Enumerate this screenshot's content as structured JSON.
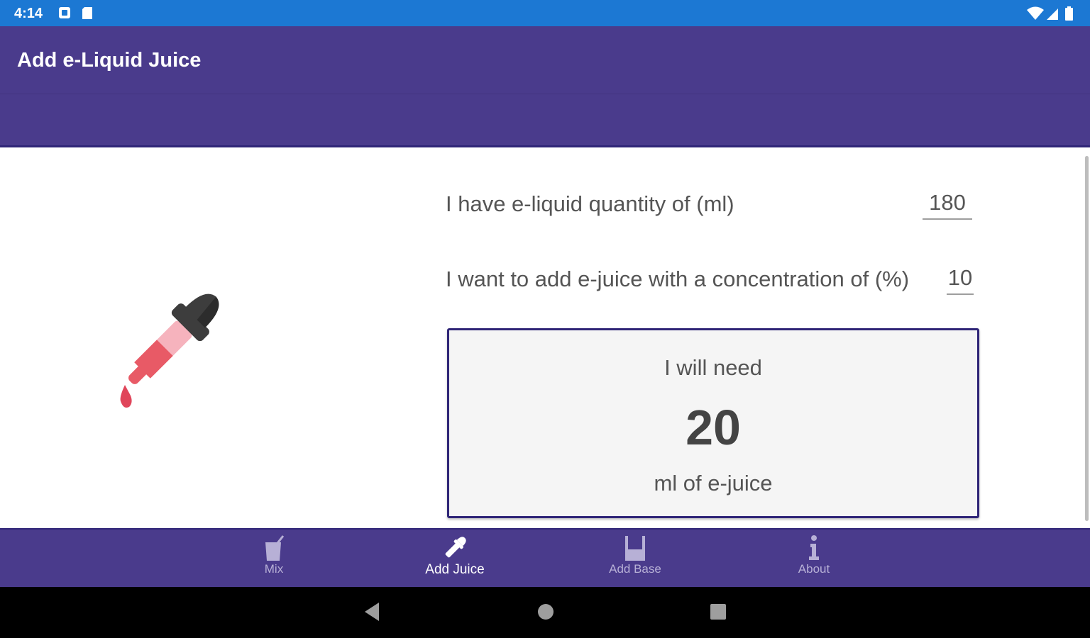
{
  "status_bar": {
    "time": "4:14",
    "icons": [
      "notification-icon",
      "sd-card-icon",
      "wifi-icon",
      "signal-icon",
      "battery-icon"
    ]
  },
  "app_bar": {
    "title": "Add e-Liquid Juice"
  },
  "illustration": {
    "icon": "dropper-icon",
    "colors": {
      "cap": "#3d3d3d",
      "tube_light": "#f6b3bd",
      "tube_dark": "#e85a66",
      "drop": "#e0455a"
    }
  },
  "form": {
    "quantity_label": "I have e-liquid quantity of (ml)",
    "quantity_value": "180",
    "concentration_label": "I want to add e-juice with a concentration of (%)",
    "concentration_value": "10"
  },
  "result": {
    "line1": "I will need",
    "value": "20",
    "line3": "ml of e-juice"
  },
  "bottom_nav": {
    "items": [
      {
        "label": "Mix",
        "icon": "mix-glass-icon",
        "active": false
      },
      {
        "label": "Add Juice",
        "icon": "dropper-icon",
        "active": true
      },
      {
        "label": "Add Base",
        "icon": "beaker-icon",
        "active": false
      },
      {
        "label": "About",
        "icon": "info-icon",
        "active": false
      }
    ]
  },
  "system_nav": {
    "buttons": [
      "back-icon",
      "home-icon",
      "recents-icon"
    ]
  },
  "colors": {
    "status_bar": "#1c78d3",
    "primary": "#4a3b8c",
    "accent_border": "#2f2577",
    "result_background": "#f5f5f5"
  }
}
